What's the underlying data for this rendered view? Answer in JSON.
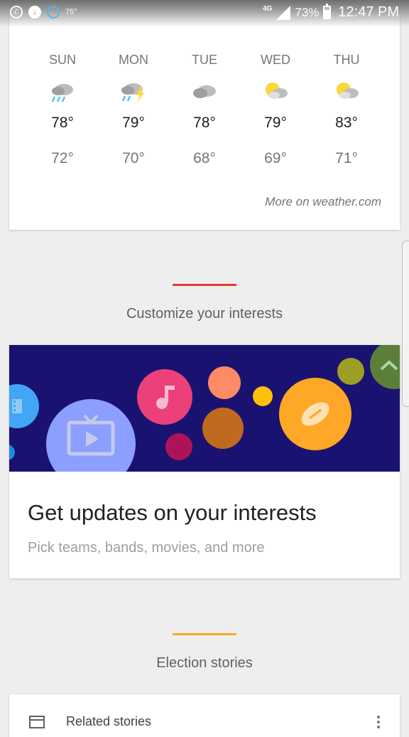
{
  "status_bar": {
    "temperature": "75°",
    "network": "4G",
    "battery_percent": "73%",
    "battery_level": 0.73,
    "time": "12:47 PM"
  },
  "weather": {
    "forecast": [
      {
        "day": "SUN",
        "icon": "rain-cloud-icon",
        "high": "78°",
        "low": "72°"
      },
      {
        "day": "MON",
        "icon": "thunderstorm-icon",
        "high": "79°",
        "low": "70°"
      },
      {
        "day": "TUE",
        "icon": "cloudy-icon",
        "high": "78°",
        "low": "68°"
      },
      {
        "day": "WED",
        "icon": "partly-sunny-icon",
        "high": "79°",
        "low": "69°"
      },
      {
        "day": "THU",
        "icon": "partly-sunny-icon",
        "high": "83°",
        "low": "71°"
      }
    ],
    "more_link": "More on weather.com"
  },
  "sections": {
    "customize": {
      "title": "Customize your interests",
      "accent": "#e53935"
    },
    "election": {
      "title": "Election stories",
      "accent": "#f9a825"
    }
  },
  "interest_card": {
    "title": "Get updates on your interests",
    "subtitle": "Pick teams, bands, movies, and more",
    "banner_color": "#1a1270",
    "icons": [
      "film-icon",
      "tv-icon",
      "music-note-icon",
      "football-icon",
      "chevron-up-icon"
    ]
  },
  "related": {
    "label": "Related stories",
    "icon": "newspaper-icon",
    "menu_icon": "more-vert-icon"
  },
  "colors": {
    "background": "#eeeeee",
    "card": "#ffffff"
  }
}
